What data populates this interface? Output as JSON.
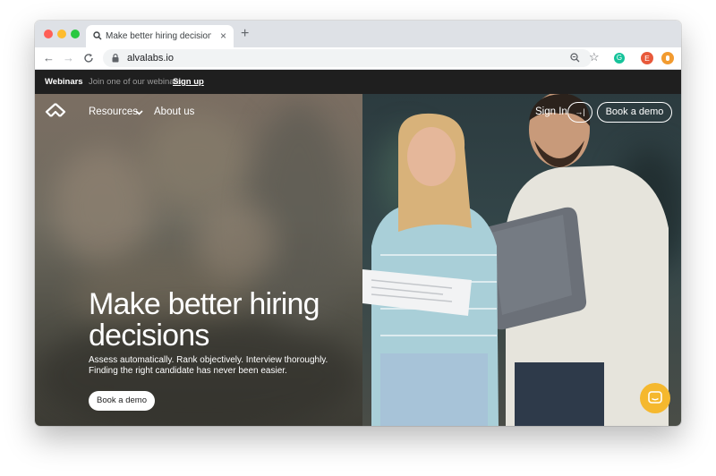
{
  "browser": {
    "tab_title": "Make better hiring decisions — ",
    "url": "alvalabs.io",
    "new_tab": "+",
    "close": "×",
    "profile_initial": "E",
    "colors": {
      "red": "#ff5f57",
      "yellow": "#febc2e",
      "green": "#28c840"
    }
  },
  "promo_bar": {
    "label": "Webinars",
    "text": "Join one of our webinars.",
    "link": "Sign up"
  },
  "site_nav": {
    "resources": "Resources",
    "about": "About us",
    "sign_in": "Sign In",
    "sign_in_icon": "→|",
    "book_demo": "Book a demo"
  },
  "hero": {
    "headline_line1": "Make better hiring",
    "headline_line2": "decisions",
    "sub_line1": "Assess automatically. Rank objectively. Interview thoroughly.",
    "sub_line2": "Finding the right candidate has never been easier.",
    "cta": "Book a demo"
  },
  "colors": {
    "chat_button": "#f5b82e",
    "promo_bg": "#1f1f1f"
  }
}
